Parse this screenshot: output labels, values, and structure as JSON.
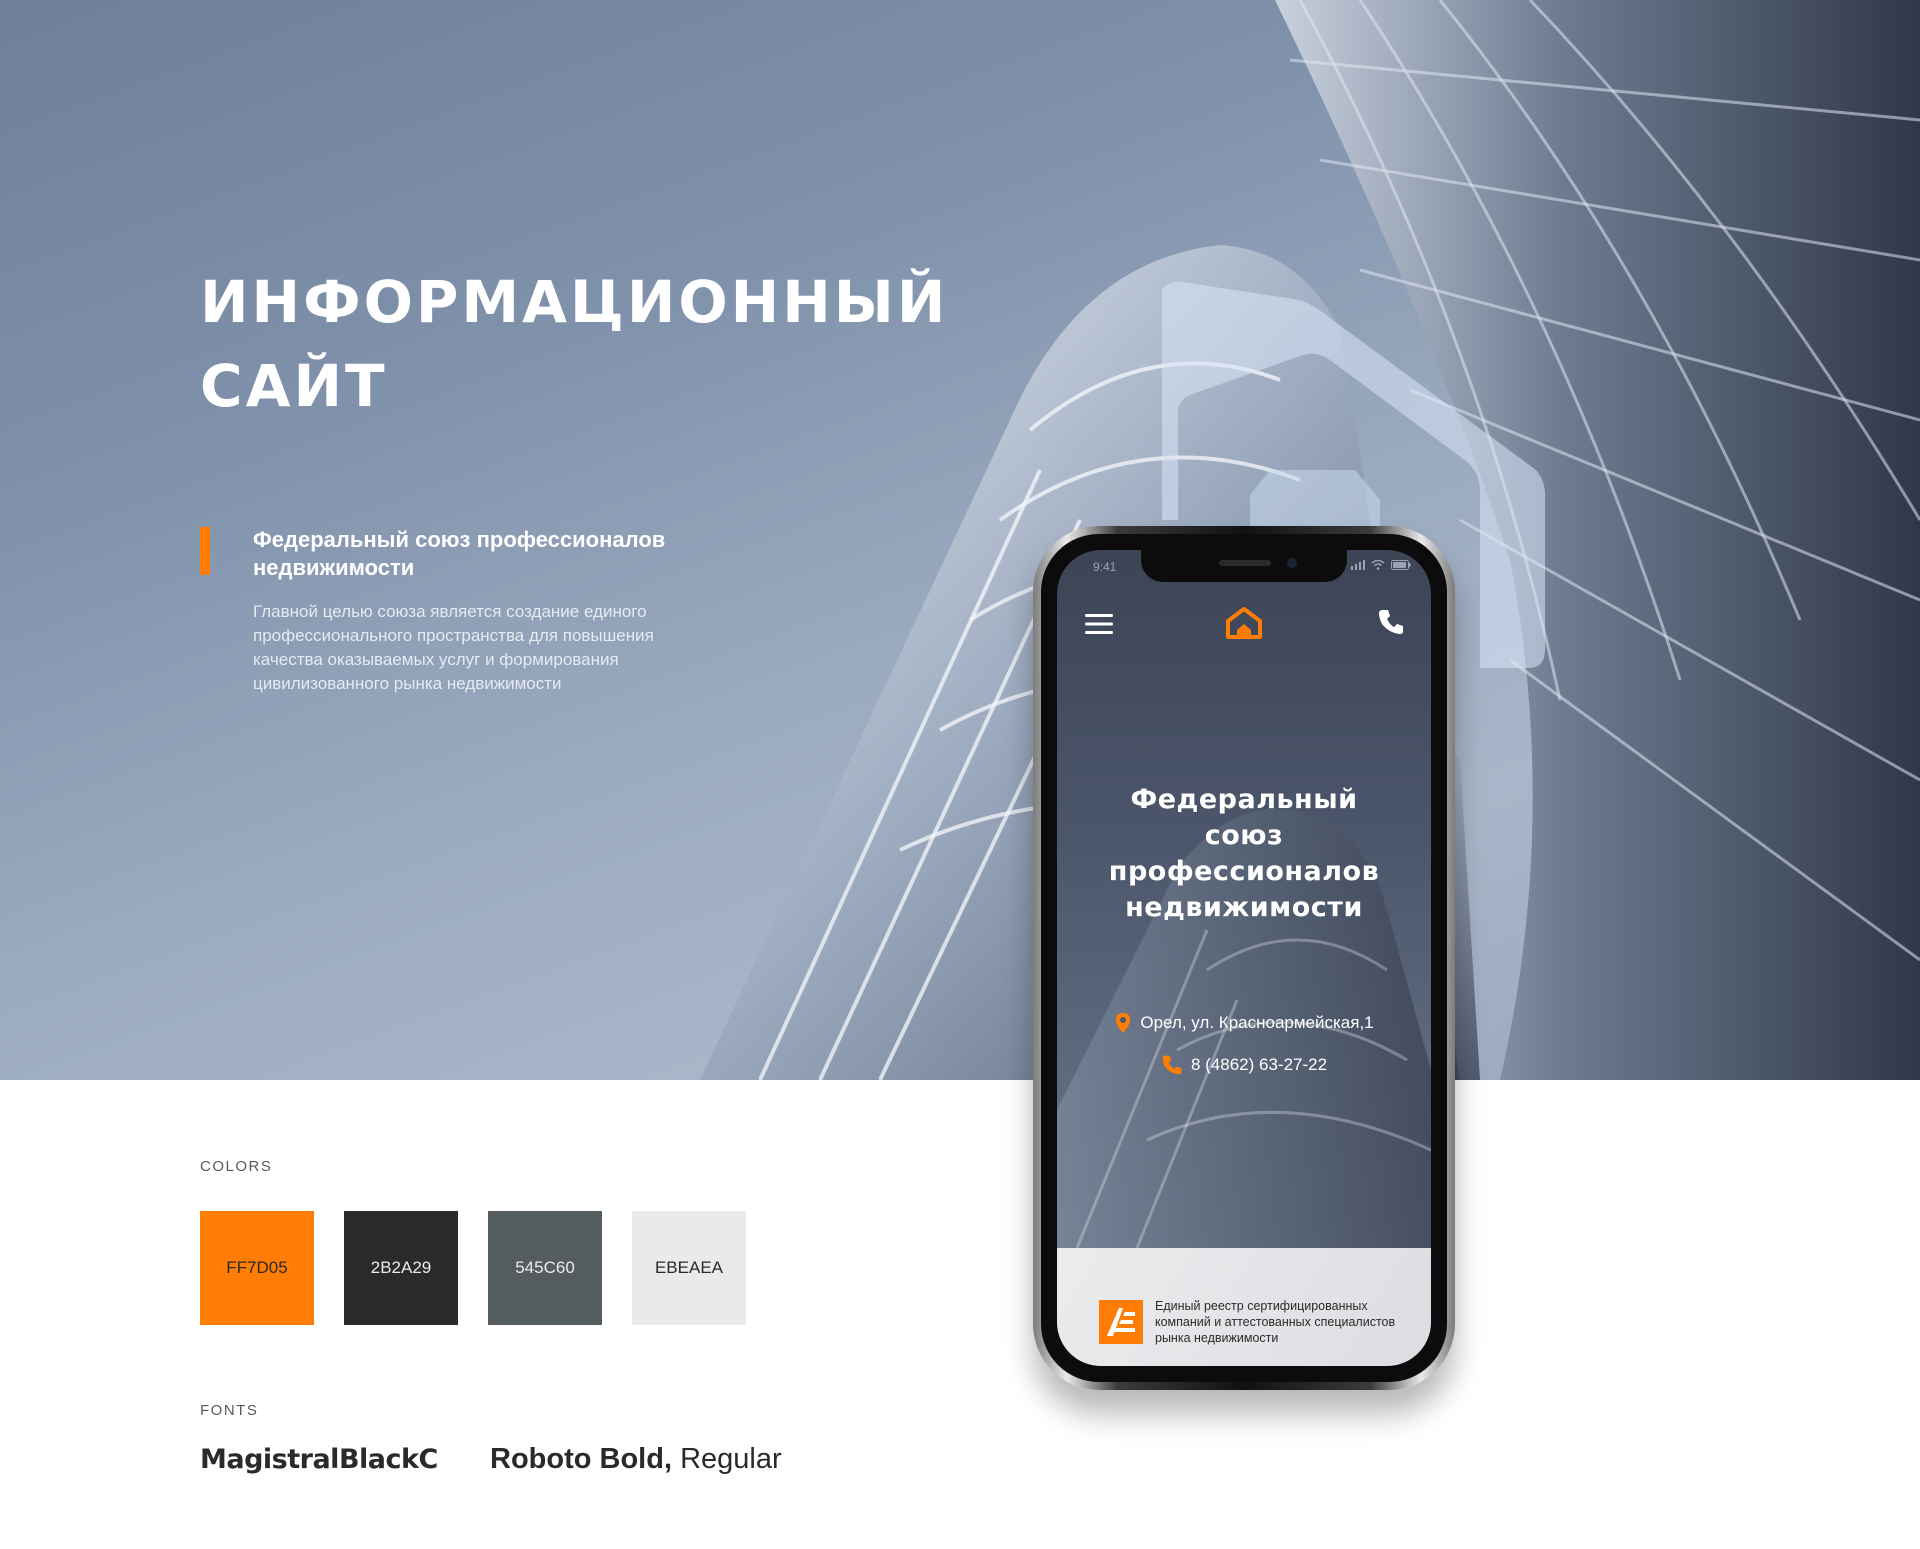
{
  "hero": {
    "title_line1": "ИНФОРМАЦИОННЫЙ",
    "title_line2": "САЙТ",
    "subtitle": "Федеральный союз профессионалов недвижимости",
    "description": "Главной целью союза является создание единого профессионального пространства для повышения качества оказываемых услуг и формирования цивилизованного рынка недвижимости"
  },
  "phone": {
    "status_time": "9:41",
    "title_lines": [
      "Федеральный",
      "союз",
      "профессионалов",
      "недвижимости"
    ],
    "address": "Орел, ул. Красноармейская,1",
    "phone_number": "8 (4862) 63-27-22",
    "footer_text": "Единый реестр сертифицированных компаний и аттестованных специалистов рынка недвижимости",
    "icons": [
      "menu-icon",
      "home-logo-icon",
      "phone-icon",
      "location-pin-icon",
      "phone-icon",
      "registry-logo-icon"
    ]
  },
  "colors_section": {
    "label": "COLORS",
    "swatches": [
      {
        "label": "FF7D05",
        "color": "#FF7D05",
        "text_color": "#2B2A29"
      },
      {
        "label": "2B2A29",
        "color": "#2B2A29",
        "text_color": "#EBEAEA"
      },
      {
        "label": "545C60",
        "color": "#545C60",
        "text_color": "#EBEAEA"
      },
      {
        "label": "EBEAEA",
        "color": "#EBEAEA",
        "text_color": "#2B2A29"
      }
    ]
  },
  "fonts_section": {
    "label": "FONTS",
    "font1": "MagistralBlackC",
    "font2_bold": "Roboto Bold,",
    "font2_regular": " Regular"
  },
  "theme": {
    "accent": "#FF7D05",
    "dark": "#2B2A29",
    "gray": "#545C60",
    "light": "#EBEAEA"
  }
}
